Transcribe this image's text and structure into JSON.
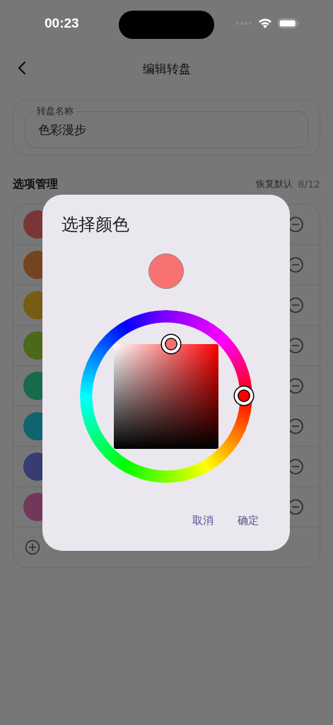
{
  "status_bar": {
    "time": "00:23"
  },
  "nav": {
    "title": "编辑转盘"
  },
  "name_field": {
    "label": "转盘名称",
    "value": "色彩漫步"
  },
  "options": {
    "title": "选项管理",
    "reset": "恢复默认",
    "count": "8/12",
    "items": [
      {
        "color": "#7a3636"
      },
      {
        "color": "#744420"
      },
      {
        "color": "#765c14"
      },
      {
        "color": "#4b6919"
      },
      {
        "color": "#19694b"
      },
      {
        "color": "#0f646e"
      },
      {
        "color": "#373c73"
      },
      {
        "color": "#73375a"
      }
    ]
  },
  "dialog": {
    "title": "选择颜色",
    "buttons": [
      "取消",
      "确定"
    ]
  }
}
